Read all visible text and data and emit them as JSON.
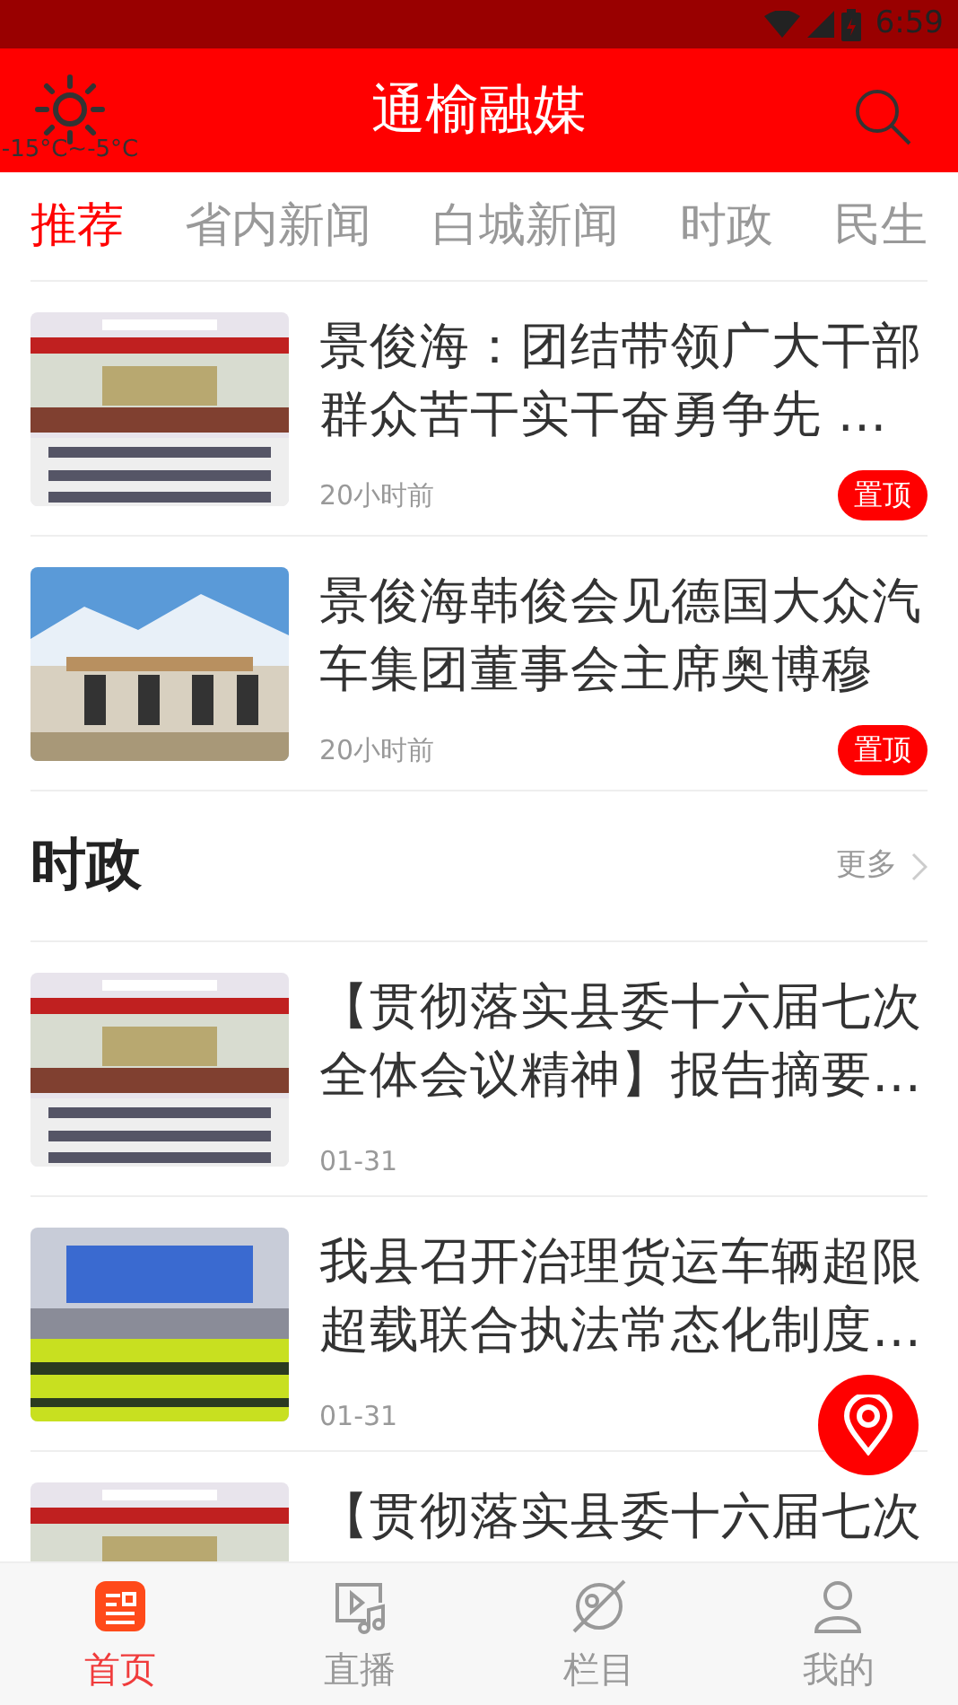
{
  "status_bar": {
    "time": "6:59"
  },
  "header": {
    "title": "通榆融媒",
    "weather": "-15°C~-5°C"
  },
  "tabs": [
    {
      "label": "推荐",
      "selected": true
    },
    {
      "label": "省内新闻",
      "selected": false
    },
    {
      "label": "白城新闻",
      "selected": false
    },
    {
      "label": "时政",
      "selected": false
    },
    {
      "label": "民生",
      "selected": false
    }
  ],
  "featured": [
    {
      "title": "景俊海：团结带领广大干部群众苦干实干奋勇争先 …",
      "time": "20小时前",
      "badge": "置顶"
    },
    {
      "title": "景俊海韩俊会见德国大众汽车集团董事会主席奥博穆",
      "time": "20小时前",
      "badge": "置顶"
    }
  ],
  "section": {
    "title": "时政",
    "more": "更多",
    "items": [
      {
        "title": "【贯彻落实县委十六届七次全体会议精神】报告摘要…",
        "time": "01-31"
      },
      {
        "title": "我县召开治理货运车辆超限超载联合执法常态化制度…",
        "time": "01-31"
      },
      {
        "title": "【贯彻落实县委十六届七次"
      }
    ]
  },
  "bottom_nav": [
    {
      "label": "首页",
      "selected": true
    },
    {
      "label": "直播",
      "selected": false
    },
    {
      "label": "栏目",
      "selected": false
    },
    {
      "label": "我的",
      "selected": false
    }
  ]
}
